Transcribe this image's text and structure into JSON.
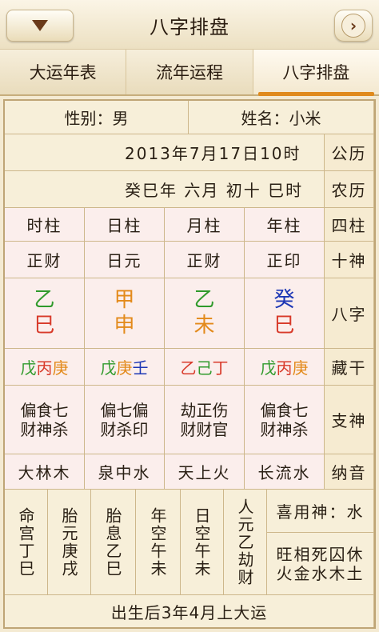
{
  "header": {
    "title": "八字排盘",
    "dropdown_icon": "triangle-down",
    "next_icon": "chevron-right"
  },
  "tabs": [
    {
      "label": "大运年表",
      "active": false
    },
    {
      "label": "流年运程",
      "active": false
    },
    {
      "label": "八字排盘",
      "active": true
    }
  ],
  "info": {
    "gender": "性别：男",
    "name": "姓名：小米",
    "gongli_label": "公历",
    "gongli_value": "2013年7月17日10时",
    "nongli_label": "农历",
    "nongli_value": "癸巳年 六月 初十 巳时"
  },
  "pillars": {
    "row_label": "四柱",
    "headers": [
      "年柱",
      "月柱",
      "日柱",
      "时柱"
    ]
  },
  "shishen": {
    "row_label": "十神",
    "values": [
      "正印",
      "正财",
      "日元",
      "正财"
    ]
  },
  "bazi": {
    "row_label": "八字",
    "columns": [
      {
        "top": "癸",
        "bottom": "巳",
        "top_color": "#1d37b5",
        "bottom_color": "#d83a2a"
      },
      {
        "top": "乙",
        "bottom": "未",
        "top_color": "#2f9a2b",
        "bottom_color": "#e38a1b"
      },
      {
        "top": "甲",
        "bottom": "申",
        "top_color": "#e38a1b",
        "bottom_color": "#e38a1b"
      },
      {
        "top": "乙",
        "bottom": "巳",
        "top_color": "#2f9a2b",
        "bottom_color": "#d83a2a"
      }
    ]
  },
  "canggan": {
    "row_label": "藏干",
    "columns": [
      [
        {
          "c": "戊",
          "color": "#2f9a2b"
        },
        {
          "c": "丙",
          "color": "#d83a2a"
        },
        {
          "c": "庚",
          "color": "#e38a1b"
        }
      ],
      [
        {
          "c": "乙",
          "color": "#d83a2a"
        },
        {
          "c": "己",
          "color": "#2f9a2b"
        },
        {
          "c": "丁",
          "color": "#d83a2a"
        }
      ],
      [
        {
          "c": "戊",
          "color": "#2f9a2b"
        },
        {
          "c": "庚",
          "color": "#e38a1b"
        },
        {
          "c": "壬",
          "color": "#1d37b5"
        }
      ],
      [
        {
          "c": "戊",
          "color": "#2f9a2b"
        },
        {
          "c": "丙",
          "color": "#d83a2a"
        },
        {
          "c": "庚",
          "color": "#e38a1b"
        }
      ]
    ]
  },
  "zhishen": {
    "row_label": "支神",
    "columns": [
      {
        "line1": "偏食七",
        "line2": "财神杀"
      },
      {
        "line1": "劫正伤",
        "line2": "财财官"
      },
      {
        "line1": "偏七偏",
        "line2": "财杀印"
      },
      {
        "line1": "偏食七",
        "line2": "财神杀"
      }
    ]
  },
  "nayin": {
    "row_label": "纳音",
    "values": [
      "长流水",
      "天上火",
      "泉中水",
      "大林木"
    ]
  },
  "bottom_cols": [
    "命宫丁巳",
    "胎元庚戌",
    "胎息乙巳",
    "年空午未",
    "日空午未",
    "人元乙劫财"
  ],
  "xiyong": {
    "label": "喜用神：水",
    "line1": "旺相死囚休",
    "line2": "火金水木土"
  },
  "footer": "出生后3年4月上大运"
}
